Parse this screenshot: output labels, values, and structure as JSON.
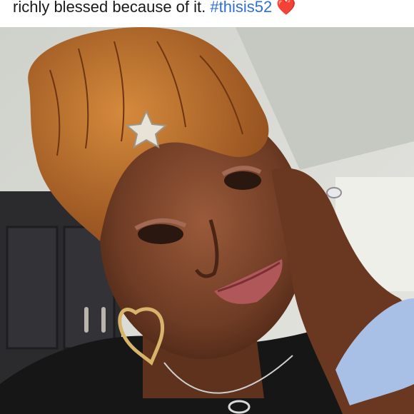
{
  "caption": {
    "text": "richly blessed because of it.",
    "hashtag": "#thisis52",
    "heart": "❤️"
  },
  "photo": {
    "subject": "selfie-photo"
  }
}
